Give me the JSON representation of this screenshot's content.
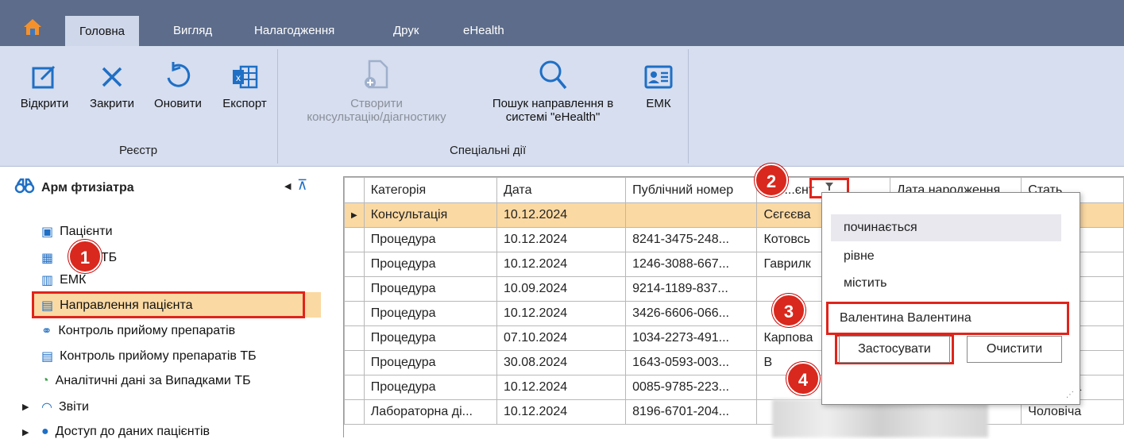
{
  "menubar": {
    "tabs": [
      {
        "label": "Головна"
      },
      {
        "label": "Вигляд"
      },
      {
        "label": "Налагодження"
      },
      {
        "label": "Друк"
      },
      {
        "label": "eHealth"
      }
    ]
  },
  "ribbon": {
    "registry": {
      "label": "Реєстр",
      "buttons": [
        {
          "label": "Відкрити"
        },
        {
          "label": "Закрити"
        },
        {
          "label": "Оновити"
        },
        {
          "label": "Експорт"
        }
      ]
    },
    "special": {
      "label": "Спеціальні дії",
      "create_line1": "Створити",
      "create_line2": "консультацію/діагностику",
      "search_line1": "Пошук направлення в",
      "search_line2": "системі \"eHealth\"",
      "emk": "ЕМК"
    }
  },
  "nav": {
    "title": "Арм фтизіатра",
    "items": [
      {
        "label": "Пацієнти"
      },
      {
        "label": "...ки ТБ"
      },
      {
        "label": "ЕМК"
      },
      {
        "label": "Направлення пацієнта"
      },
      {
        "label": "Контроль прийому препаратів"
      },
      {
        "label": "Контроль прийому препаратів ТБ"
      },
      {
        "label": "Аналітичні дані за Випадками ТБ"
      },
      {
        "label": "Звіти"
      },
      {
        "label": "Доступ до даних пацієнтів"
      }
    ]
  },
  "grid": {
    "headers": [
      "Категорія",
      "Дата",
      "Публічний номер",
      "...єнт",
      "Дата народження",
      "Стать"
    ],
    "rows": [
      [
        "Консультація",
        "10.12.2024",
        "",
        "Сєгєєва",
        ""
      ],
      [
        "Процедура",
        "10.12.2024",
        "8241-3475-248...",
        "Котовсь",
        ""
      ],
      [
        "Процедура",
        "10.12.2024",
        "1246-3088-667...",
        "Гаврилк",
        ""
      ],
      [
        "Процедура",
        "10.09.2024",
        "9214-1189-837...",
        "",
        ""
      ],
      [
        "Процедура",
        "10.12.2024",
        "3426-6606-066...",
        "",
        ""
      ],
      [
        "Процедура",
        "07.10.2024",
        "1034-2273-491...",
        "Карпова",
        ""
      ],
      [
        "Процедура",
        "30.08.2024",
        "1643-0593-003...",
        "В",
        ""
      ],
      [
        "Процедура",
        "10.12.2024",
        "0085-9785-223...",
        "",
        "Чоловіча"
      ],
      [
        "Лабораторна ді...",
        "10.12.2024",
        "8196-6701-204...",
        "",
        "Чоловіча"
      ]
    ]
  },
  "filter": {
    "options": [
      {
        "label": "починається"
      },
      {
        "label": "рівне"
      },
      {
        "label": "містить"
      }
    ],
    "value": "Валентина Валентина",
    "apply": "Застосувати",
    "clear": "Очистити"
  },
  "callouts": [
    "1",
    "2",
    "3",
    "4"
  ],
  "colors": {
    "menubar": "#5d6c8a",
    "ribbon": "#d6deef",
    "selection": "#fbd9a3",
    "callout": "#d9281d"
  }
}
